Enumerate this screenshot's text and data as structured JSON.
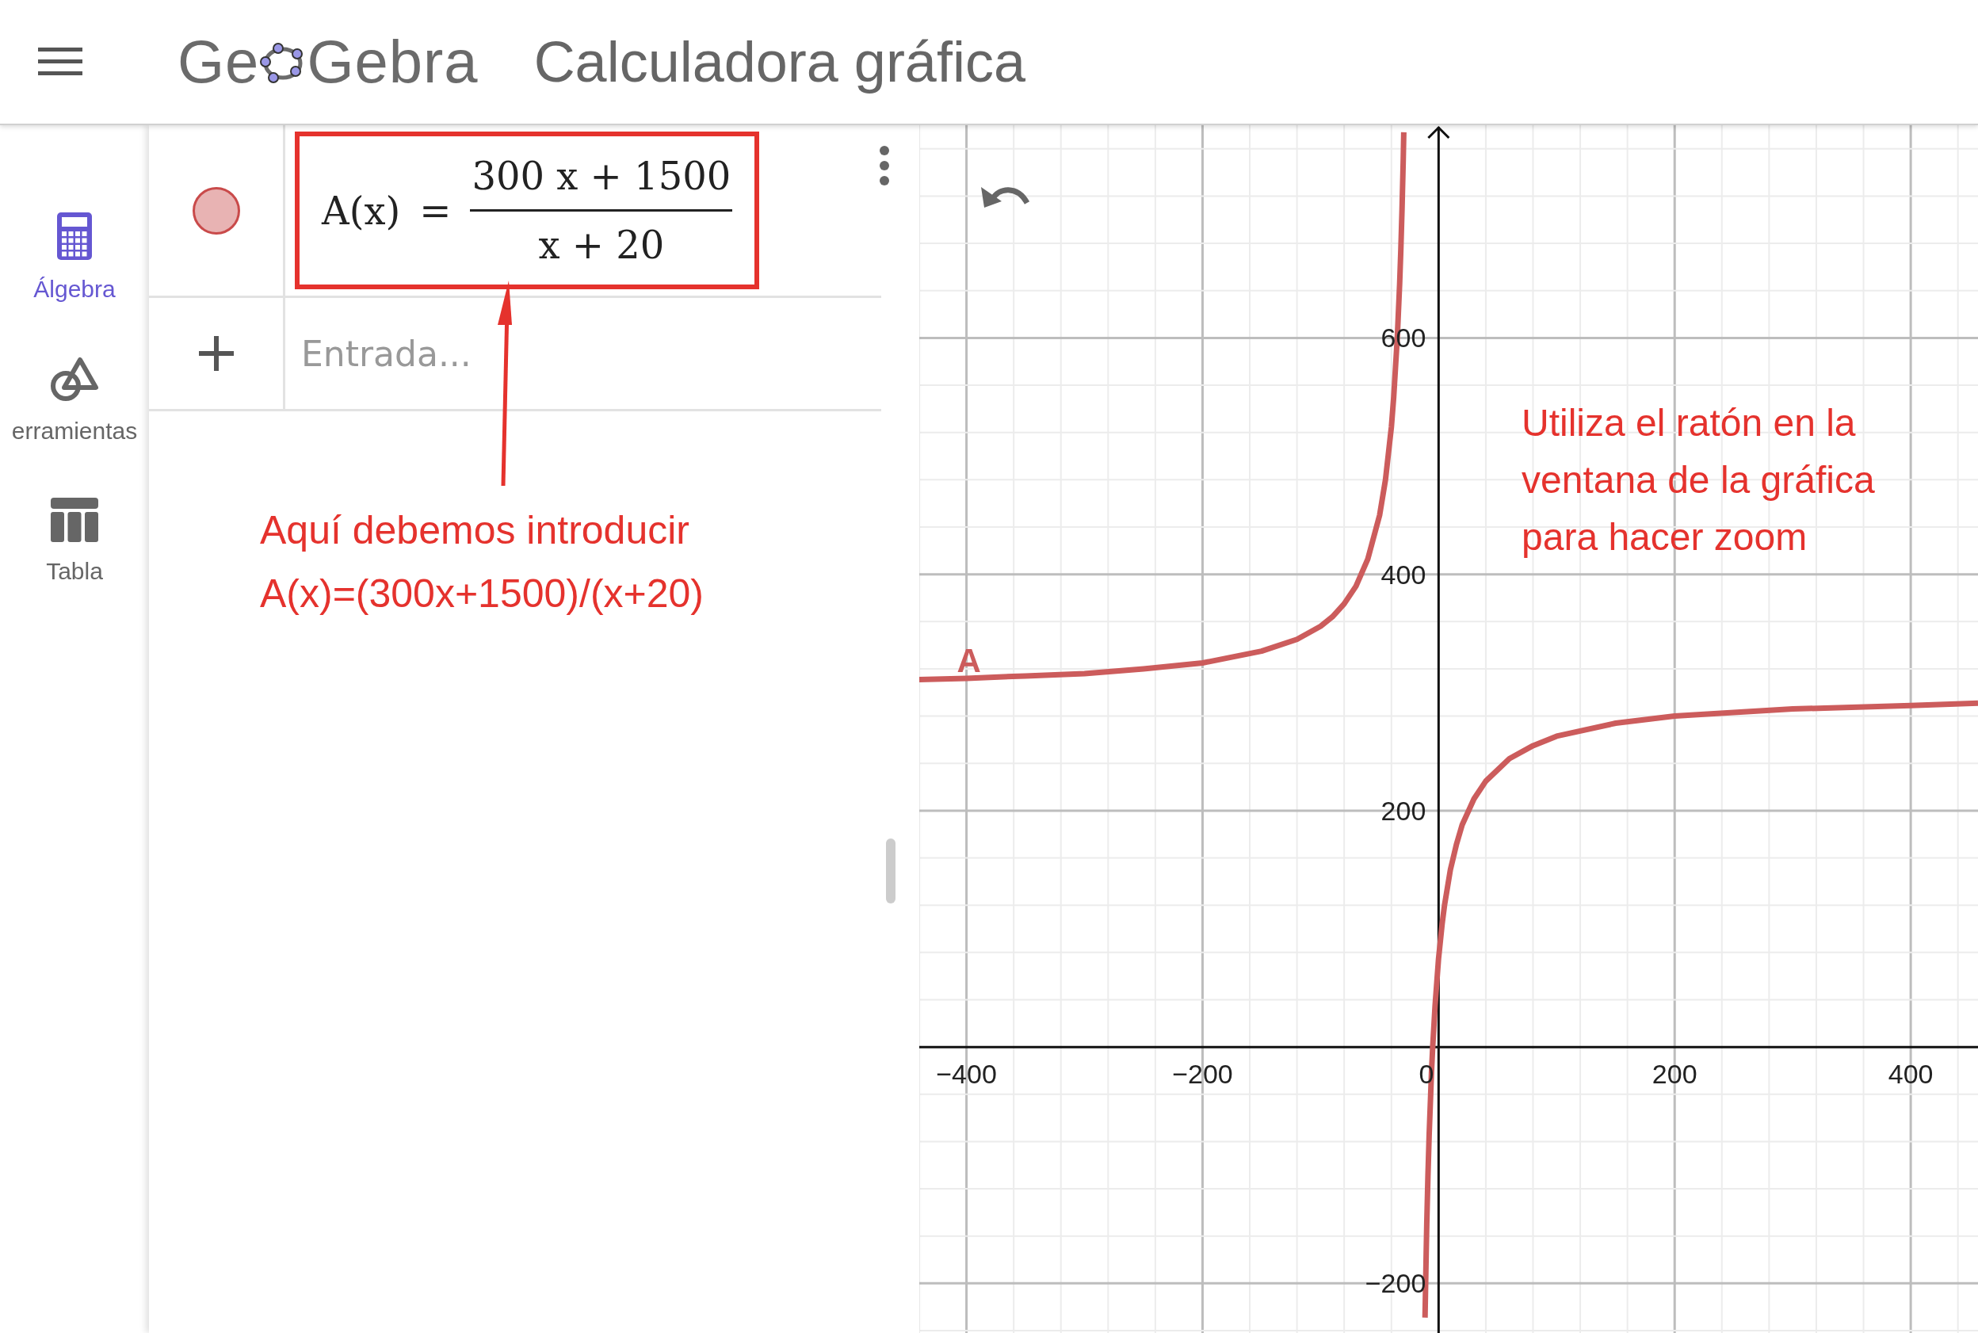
{
  "header": {
    "logo_left": "Ge",
    "logo_right": "Gebra",
    "title": "Calculadora gráfica"
  },
  "sidebar": {
    "items": [
      {
        "kind": "calculator",
        "label": "Álgebra",
        "selected": true
      },
      {
        "kind": "tools",
        "label": "erramientas",
        "selected": false
      },
      {
        "kind": "table",
        "label": "Tabla",
        "selected": false
      }
    ]
  },
  "algebra": {
    "rows": [
      {
        "kind": "formula",
        "visible": true,
        "color": "#e8b3b3",
        "lhs": "A(x)",
        "equals": "=",
        "numerator": "300 x + 1500",
        "denominator": "x + 20",
        "highlighted": true
      },
      {
        "kind": "input",
        "placeholder": "Entrada..."
      }
    ]
  },
  "note_left": {
    "lines": [
      "Aquí debemos introducir",
      "A(x)=(300x+1500)/(x+20)"
    ]
  },
  "graph": {
    "note": {
      "lines": [
        "Utiliza el ratón en la",
        "ventana de la gráfica",
        "para hacer zoom"
      ]
    },
    "chart_data": {
      "type": "line",
      "grid": true,
      "xlim": [
        -440,
        457
      ],
      "ylim": [
        -242,
        780
      ],
      "xticks": [
        {
          "value": -400,
          "label": "−400"
        },
        {
          "value": -200,
          "label": "−200"
        },
        {
          "value": 0,
          "label": "0"
        },
        {
          "value": 200,
          "label": "200"
        },
        {
          "value": 400,
          "label": "400"
        }
      ],
      "yticks": [
        {
          "value": -200,
          "label": "−200"
        },
        {
          "value": 200,
          "label": "200"
        },
        {
          "value": 400,
          "label": "400"
        },
        {
          "value": 600,
          "label": "600"
        }
      ],
      "x": [
        -440,
        -400,
        -350,
        -300,
        -250,
        -200,
        -150,
        -120,
        -100,
        -90,
        -80,
        -70,
        -60,
        -50,
        -45,
        -40,
        -38,
        -35,
        -33,
        -32,
        -31,
        -30,
        -29.5,
        -20,
        -11.5,
        -11,
        -10.5,
        -10,
        -9,
        -8,
        -6,
        -5,
        -3,
        0,
        3,
        5,
        10,
        15,
        20,
        30,
        40,
        60,
        80,
        100,
        150,
        200,
        300,
        400,
        457
      ],
      "series": [
        {
          "name": "A",
          "color": "#cc5c5c",
          "values": [
            311,
            312,
            314,
            316,
            320,
            325,
            335,
            345,
            356,
            364,
            375,
            390,
            413,
            450,
            480,
            525,
            550,
            600,
            646,
            675,
            709,
            750,
            774,
            null,
            -229,
            -200,
            -174,
            -150,
            -109,
            -75,
            -21,
            0,
            35,
            75,
            104,
            120,
            150,
            171,
            188,
            210,
            225,
            244,
            255,
            263,
            274,
            280,
            286,
            289,
            291
          ]
        }
      ]
    }
  }
}
